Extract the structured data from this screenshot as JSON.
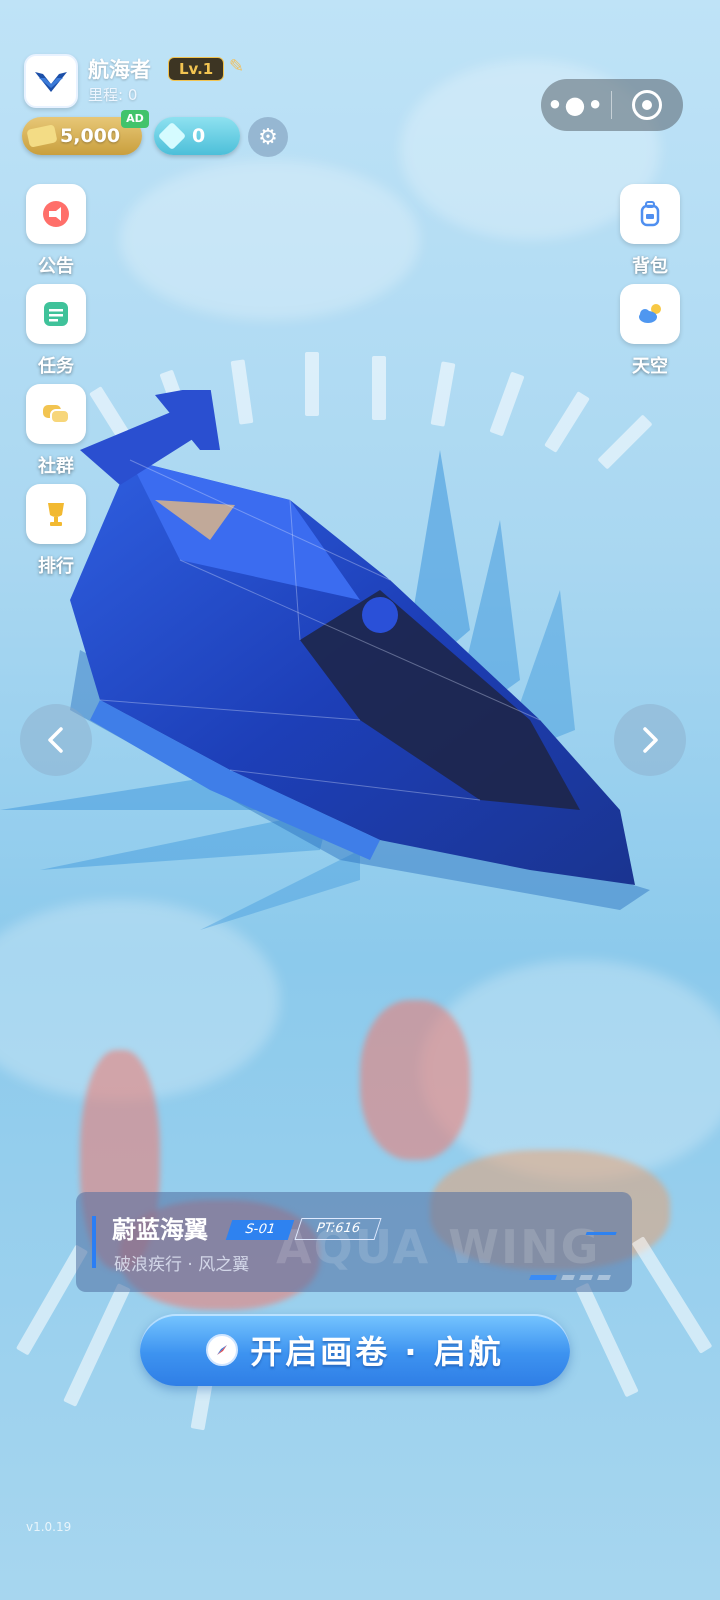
{
  "player": {
    "name": "航海者",
    "level": "Lv.1",
    "mileage": "里程: 0"
  },
  "currency": {
    "gold": "5,000",
    "gold_ad_badge": "AD",
    "gems": "0"
  },
  "left_menu": [
    {
      "label": "公告",
      "icon": "megaphone-icon"
    },
    {
      "label": "任务",
      "icon": "task-list-icon"
    },
    {
      "label": "社群",
      "icon": "chat-bubbles-icon"
    },
    {
      "label": "排行",
      "icon": "trophy-icon"
    }
  ],
  "right_menu": [
    {
      "label": "背包",
      "icon": "backpack-icon"
    },
    {
      "label": "天空",
      "icon": "weather-cloud-icon"
    }
  ],
  "ship": {
    "name": "蔚蓝海翼",
    "code": "S-01",
    "pt": "PT:616",
    "subtitle": "破浪疾行 · 风之翼",
    "watermark": "AQUA WING"
  },
  "cta_label": "开启画卷 · 启航",
  "version": "v1.0.19",
  "colors": {
    "accent": "#2e82f0",
    "gold": "#d4af55",
    "gem": "#5cc8df"
  }
}
